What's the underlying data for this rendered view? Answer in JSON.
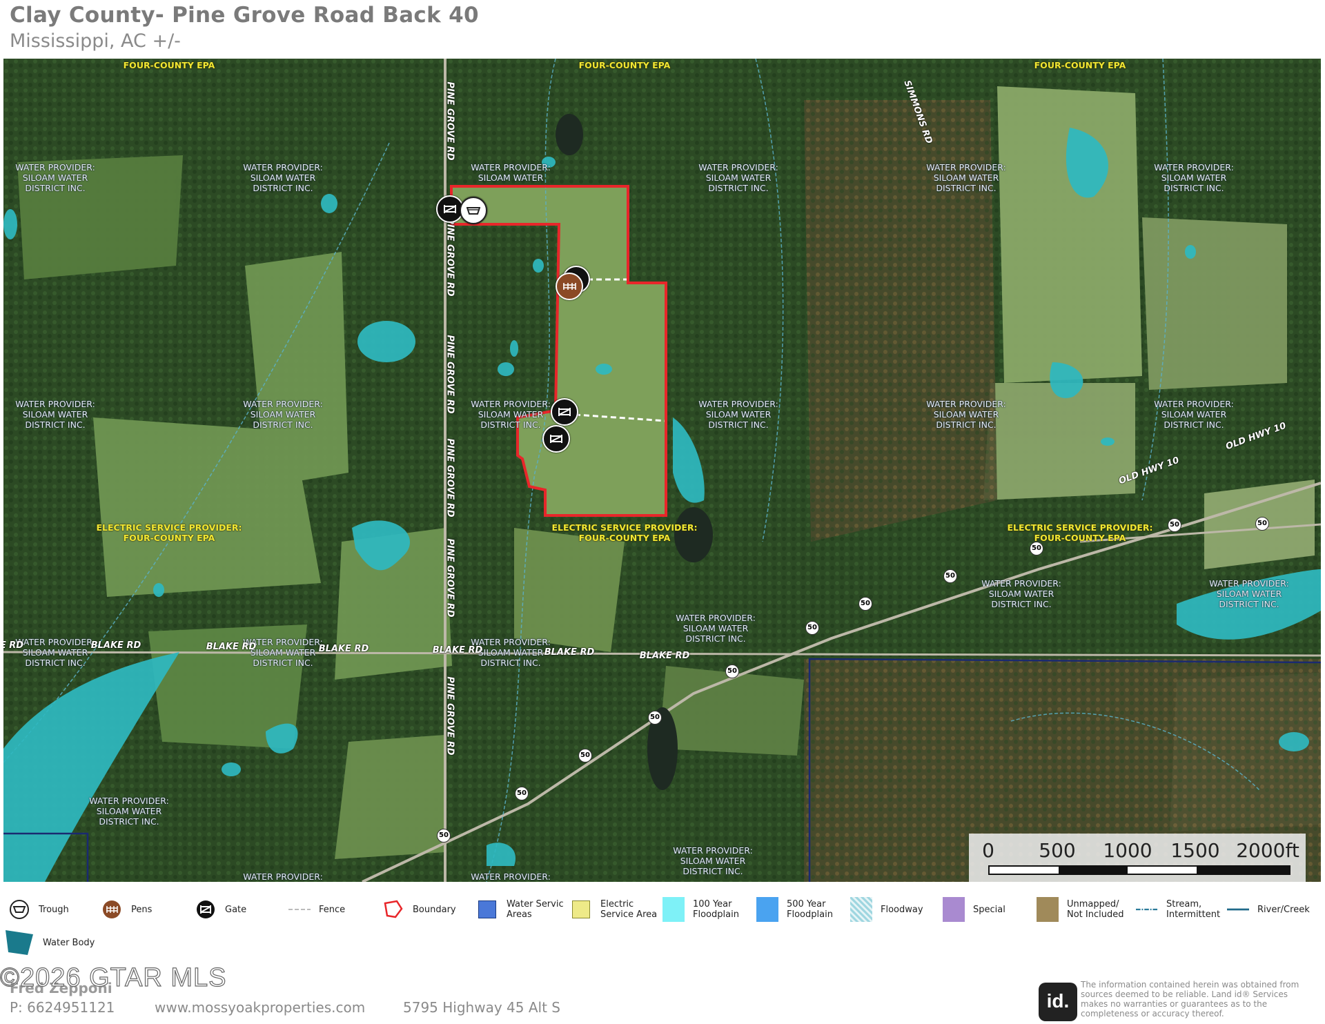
{
  "header": {
    "title": "Clay County- Pine Grove Road Back 40",
    "subtitle": "Mississippi,  AC +/-"
  },
  "colors": {
    "boundary": "#e8262a",
    "water_body": "#2fb8c0",
    "electric_label": "#f1e733",
    "gate": "#111111",
    "pens": "#8b4a26"
  },
  "map": {
    "labels": {
      "electric_provider": "ELECTRIC SERVICE PROVIDER:",
      "four_county": "FOUR-COUNTY EPA",
      "water_provider": "WATER PROVIDER:",
      "siloam_1": "SILOAM WATER",
      "siloam_2": "DISTRICT  INC."
    },
    "roads": {
      "pine_grove": "PINE GROVE RD",
      "blake": "BLAKE RD",
      "blake_cut": "E RD",
      "old_hwy": "OLD HWY 10",
      "simmons": "SIMMONS RD",
      "hwy50": "50"
    },
    "features": [
      "boundary",
      "gate-icon",
      "trough-icon",
      "pens-icon",
      "fence",
      "water-body"
    ]
  },
  "scale": {
    "ticks": [
      "0",
      "500",
      "1000",
      "1500",
      "2000ft"
    ]
  },
  "legend": [
    {
      "icon": "trough-icon",
      "label": "Trough"
    },
    {
      "icon": "pens-icon",
      "label": "Pens"
    },
    {
      "icon": "gate-icon",
      "label": "Gate"
    },
    {
      "icon": "fence-icon",
      "label": "Fence"
    },
    {
      "icon": "boundary-icon",
      "label": "Boundary"
    },
    {
      "icon": "water-service-icon",
      "label_1": "Water Servic",
      "label_2": "Areas",
      "color": "#4a78d8"
    },
    {
      "icon": "electric-service-icon",
      "label_1": "Electric",
      "label_2": "Service Area",
      "color": "#eeea88"
    },
    {
      "icon": "floodplain-100-icon",
      "label_1": "100 Year",
      "label_2": "Floodplain",
      "color": "#7ef1f7"
    },
    {
      "icon": "floodplain-500-icon",
      "label_1": "500 Year",
      "label_2": "Floodplain",
      "color": "#4aa3f0"
    },
    {
      "icon": "floodway-icon",
      "label": "Floodway",
      "color": "#9fd6e0"
    },
    {
      "icon": "special-icon",
      "label": "Special",
      "color": "#a98ad0"
    },
    {
      "icon": "unmapped-icon",
      "label_1": "Unmapped/",
      "label_2": "Not Included",
      "color": "#a08a5a"
    },
    {
      "icon": "stream-icon",
      "label_1": "Stream,",
      "label_2": "Intermittent",
      "color": "#2a7a9a"
    },
    {
      "icon": "river-icon",
      "label": "River/Creek",
      "color": "#1f6a8a"
    },
    {
      "icon": "water-body-icon",
      "label": "Water Body",
      "color": "#1a7a8c"
    }
  ],
  "footer": {
    "copyright": "©2026 GTAR MLS",
    "agent": "Fred Zepponi",
    "phone": "P: 6624951121",
    "website": "www.mossyoakproperties.com",
    "address": "5795 Highway 45 Alt S",
    "logo": "id.",
    "disclaimer": "The information contained herein was obtained from sources deemed to be reliable.  Land id® Services makes no warranties or guarantees as to the completeness or accuracy thereof."
  }
}
